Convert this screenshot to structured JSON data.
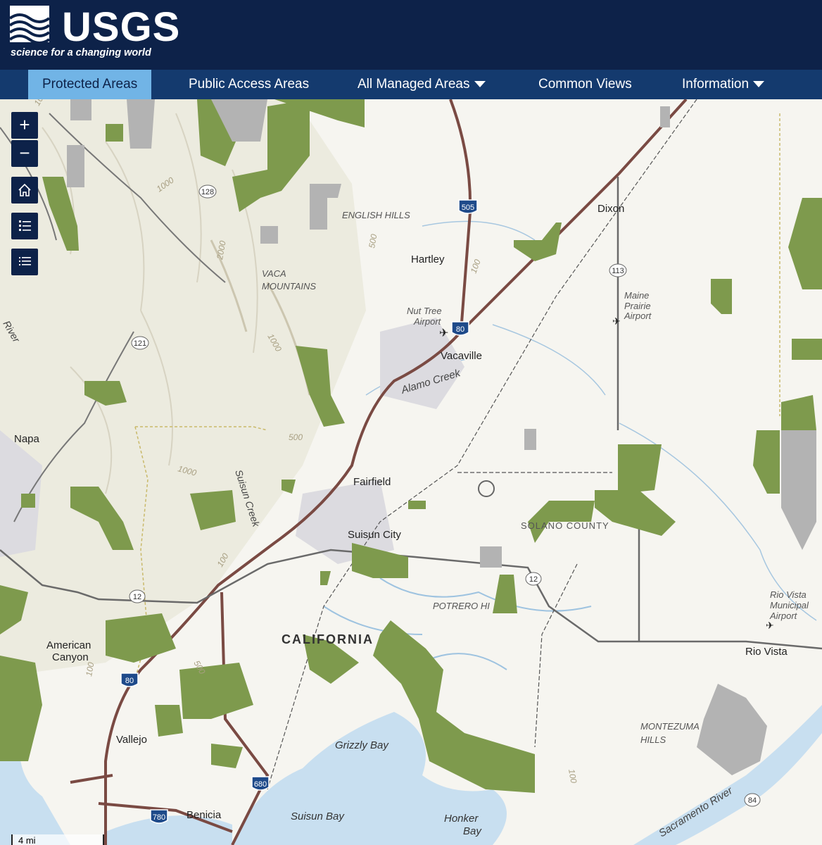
{
  "header": {
    "logo_text": "USGS",
    "logo_tagline": "science for a changing world"
  },
  "nav": {
    "items": [
      {
        "label": "Protected Areas",
        "active": true,
        "has_dropdown": false
      },
      {
        "label": "Public Access Areas",
        "active": false,
        "has_dropdown": false
      },
      {
        "label": "All Managed Areas",
        "active": false,
        "has_dropdown": true
      },
      {
        "label": "Common Views",
        "active": false,
        "has_dropdown": false
      },
      {
        "label": "Information",
        "active": false,
        "has_dropdown": true
      }
    ]
  },
  "controls": {
    "zoom_in": "+",
    "zoom_out": "−",
    "icons": [
      "home-icon",
      "legend-icon",
      "layer-list-icon"
    ]
  },
  "colors": {
    "header_bg": "#0d2249",
    "nav_bg": "#143a6e",
    "nav_active": "#71b4e6",
    "protected_area": "#7e9a4d",
    "other_area": "#b3b3b3",
    "water": "#c8dff0",
    "interstate": "#7a4a43"
  },
  "map": {
    "places": {
      "dixon": "Dixon",
      "hartley": "Hartley",
      "vacaville": "Vacaville",
      "fairfield": "Fairfield",
      "suisun_city": "Suisun City",
      "napa": "Napa",
      "american_canyon_1": "American",
      "american_canyon_2": "Canyon",
      "vallejo": "Vallejo",
      "benicia": "Benicia",
      "rio_vista": "Rio Vista"
    },
    "features": {
      "english_hills": "ENGLISH HILLS",
      "vaca_mountains_1": "VACA",
      "vaca_mountains_2": "MOUNTAINS",
      "potrero_hills": "POTRERO HI",
      "montezuma_hills_1": "MONTEZUMA",
      "montezuma_hills_2": "HILLS",
      "california": "CALIFORNIA",
      "solano_county": "SOLANO COUNTY",
      "grizzly_bay": "Grizzly Bay",
      "suisun_bay": "Suisun Bay",
      "honker_bay_1": "Honker",
      "honker_bay_2": "Bay",
      "alamo_creek": "Alamo Creek",
      "suisun_creek": "Suisun Creek",
      "sacramento_river": "Sacramento River",
      "napa_river": "River"
    },
    "airports": {
      "nut_tree_1": "Nut Tree",
      "nut_tree_2": "Airport",
      "maine_prairie_1": "Maine",
      "maine_prairie_2": "Prairie",
      "maine_prairie_3": "Airport",
      "rio_vista_1": "Rio Vista",
      "rio_vista_2": "Municipal",
      "rio_vista_3": "Airport"
    },
    "shields": {
      "i505": "505",
      "i80_a": "80",
      "i80_b": "80",
      "i680": "680",
      "i780": "780",
      "sr128": "128",
      "sr121": "121",
      "sr113": "113",
      "sr12_a": "12",
      "sr12_b": "12",
      "sr84": "84"
    },
    "contours": {
      "c1000_a": "1000",
      "c2000": "2000",
      "c500_a": "500",
      "c100_a": "100",
      "c1000_b": "1000",
      "c500_b": "500",
      "c1000_c": "1000",
      "c100_b": "100",
      "c500_c": "500",
      "c100_c": "100",
      "c100_d": "100",
      "c100_e": "100"
    },
    "scale": "4 mi"
  }
}
